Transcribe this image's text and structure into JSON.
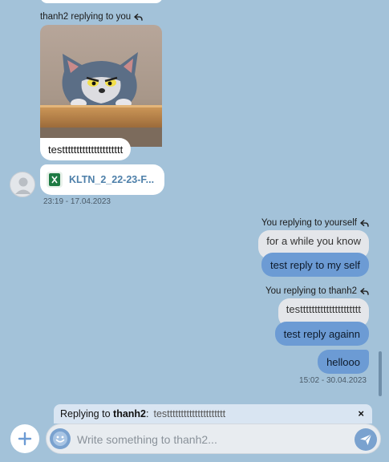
{
  "incoming": {
    "reply_header_text": "thanh2 replying to you",
    "text_message": "testtttttttttttttttttttt",
    "file_name": "KLTN_2_22-23-F...",
    "file_icon": "excel-file-icon",
    "timestamp": "23:19 - 17.04.2023"
  },
  "outgoing": {
    "group1": {
      "reply_header_text": "You replying to yourself",
      "quoted_text": "for a while you know",
      "message": "test reply to my self"
    },
    "group2": {
      "reply_header_text": "You replying to thanh2",
      "quoted_text": "testtttttttttttttttttttt",
      "message1": "test reply againn",
      "message2": "hellooo",
      "timestamp": "15:02 - 30.04.2023"
    }
  },
  "composer": {
    "reply_label": "Replying to",
    "reply_to_name": "thanh2",
    "reply_colon": ":",
    "reply_excerpt": "testtttttttttttttttttttt",
    "close_label": "×",
    "input_placeholder": "Write something to thanh2...",
    "add_label": "+"
  },
  "colors": {
    "background": "#a3c2d9",
    "outgoing_bubble": "#6c9bd4",
    "quoted_bubble": "#e4e6ea",
    "incoming_bubble": "#ffffff",
    "accent": "#7aa2cf"
  }
}
